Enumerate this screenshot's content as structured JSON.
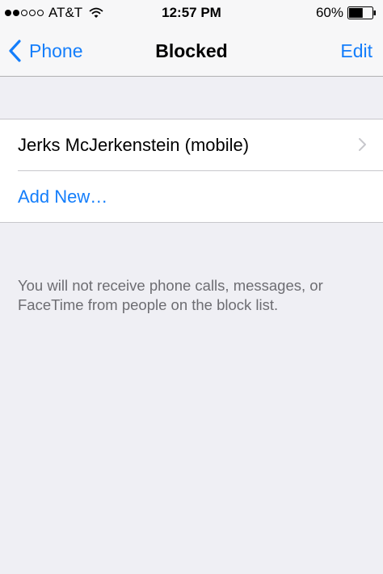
{
  "status_bar": {
    "signal_bars_filled": 2,
    "signal_bars_total": 5,
    "carrier": "AT&T",
    "time": "12:57 PM",
    "battery_percent": "60%",
    "battery_level": 0.6
  },
  "nav": {
    "back_label": "Phone",
    "title": "Blocked",
    "edit_label": "Edit"
  },
  "blocked_list": {
    "items": [
      {
        "label": "Jerks McJerkenstein (mobile)"
      }
    ],
    "add_label": "Add New…"
  },
  "footer_note": "You will not receive phone calls, messages, or FaceTime from people on the block list.",
  "colors": {
    "accent": "#147efb",
    "background": "#efeff4",
    "footer_text": "#6d6d72"
  },
  "icons": [
    "signal-icon",
    "wifi-icon",
    "battery-icon",
    "chevron-left-icon",
    "chevron-right-icon"
  ]
}
